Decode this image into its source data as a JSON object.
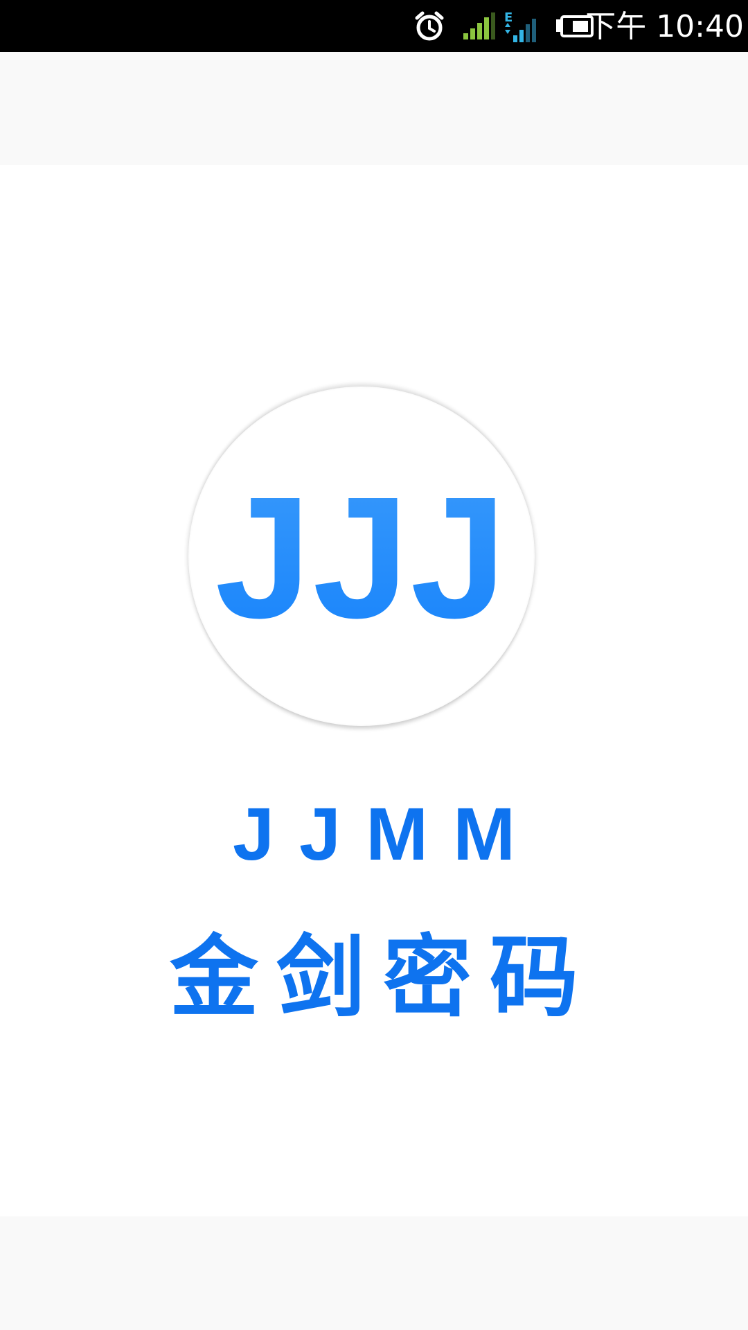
{
  "status_bar": {
    "time": "下午 10:40",
    "icons": [
      "alarm-icon",
      "signal-strength-icon",
      "mobile-data-signal-icon",
      "battery-icon"
    ],
    "colors": {
      "background": "#000000",
      "text": "#ffffff",
      "signal_green": "#8bc53f",
      "data_blue": "#33b5e5"
    }
  },
  "splash": {
    "logo_text": "JJJ",
    "brand_latin": "JJMM",
    "brand_cn": "金剑密码",
    "colors": {
      "brand_blue": "#0e73ef",
      "logo_gradient_top": "#45a2fb",
      "logo_gradient_bottom": "#0b7bfb",
      "panel": "#ffffff",
      "background": "#f9f9f9"
    }
  }
}
